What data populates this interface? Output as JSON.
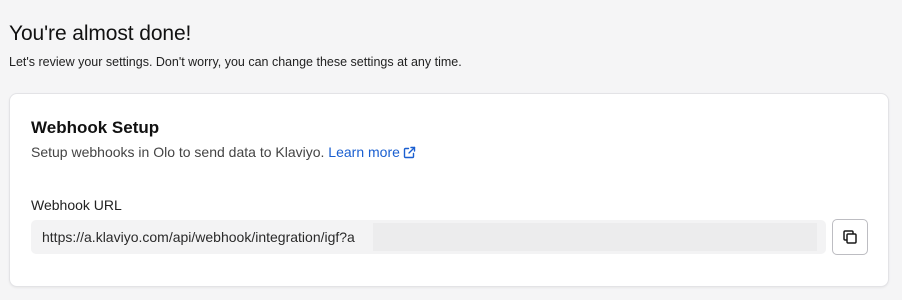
{
  "header": {
    "title": "You're almost done!",
    "subtitle": "Let's review your settings. Don't worry, you can change these settings at any time."
  },
  "webhook_card": {
    "title": "Webhook Setup",
    "description": "Setup webhooks in Olo to send data to Klaviyo.",
    "learn_more_label": "Learn more",
    "external_link_icon": "external-link-icon",
    "url_label": "Webhook URL",
    "url_value": "https://a.klaviyo.com/api/webhook/integration/igf?a",
    "copy_icon": "copy-icon"
  },
  "colors": {
    "page_background": "#f5f5f6",
    "card_background": "#ffffff",
    "link": "#1a5fd0",
    "field_background": "#f3f3f4"
  }
}
